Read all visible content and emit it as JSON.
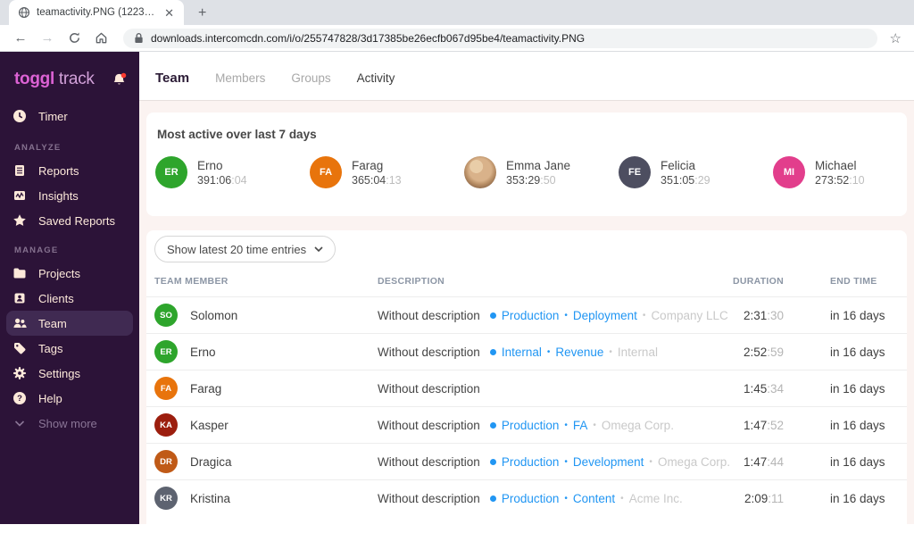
{
  "browser": {
    "tab_title": "teamactivity.PNG (1223×630)",
    "url": "downloads.intercomcdn.com/i/o/255747828/3d17385be26ecfb067d95be4/teamactivity.PNG"
  },
  "sidebar": {
    "logo_bold": "toggl",
    "logo_light": "track",
    "timer_label": "Timer",
    "analyze_label": "ANALYZE",
    "manage_label": "MANAGE",
    "analyze_items": [
      "Reports",
      "Insights",
      "Saved Reports"
    ],
    "manage_items": [
      "Projects",
      "Clients",
      "Team",
      "Tags",
      "Settings",
      "Help"
    ],
    "show_more_label": "Show more"
  },
  "topnav": {
    "title": "Team",
    "tabs": [
      "Members",
      "Groups",
      "Activity"
    ]
  },
  "most_active": {
    "title": "Most active over last 7 days",
    "people": [
      {
        "initials": "ER",
        "name": "Erno",
        "time_main": "391:06",
        "time_sec": ":04",
        "color": "#2EA52C"
      },
      {
        "initials": "FA",
        "name": "Farag",
        "time_main": "365:04",
        "time_sec": ":13",
        "color": "#E8740C"
      },
      {
        "initials": "",
        "name": "Emma Jane",
        "time_main": "353:29",
        "time_sec": ":50",
        "photo": true
      },
      {
        "initials": "FE",
        "name": "Felicia",
        "time_main": "351:05",
        "time_sec": ":29",
        "color": "#4D4E60"
      },
      {
        "initials": "MI",
        "name": "Michael",
        "time_main": "273:52",
        "time_sec": ":10",
        "color": "#E23E8C"
      }
    ]
  },
  "filter": {
    "label": "Show latest 20 time entries"
  },
  "table": {
    "headers": [
      "TEAM MEMBER",
      "DESCRIPTION",
      "DURATION",
      "END TIME"
    ],
    "rows": [
      {
        "initials": "SO",
        "color": "#2EA52C",
        "name": "Solomon",
        "description": "Without description",
        "project": "Production",
        "task": "Deployment",
        "client": "Company LLC",
        "duration_main": "2:31",
        "duration_sec": ":30",
        "end_time": "in 16 days"
      },
      {
        "initials": "ER",
        "color": "#2EA52C",
        "name": "Erno",
        "description": "Without description",
        "project": "Internal",
        "task": "Revenue",
        "client": "Internal",
        "duration_main": "2:52",
        "duration_sec": ":59",
        "end_time": "in 16 days"
      },
      {
        "initials": "FA",
        "color": "#E8740C",
        "name": "Farag",
        "description": "Without description",
        "project": "",
        "task": "",
        "client": "",
        "duration_main": "1:45",
        "duration_sec": ":34",
        "end_time": "in 16 days"
      },
      {
        "initials": "KA",
        "color": "#9C1E0E",
        "name": "Kasper",
        "description": "Without description",
        "project": "Production",
        "task": "FA",
        "client": "Omega Corp.",
        "duration_main": "1:47",
        "duration_sec": ":52",
        "end_time": "in 16 days"
      },
      {
        "initials": "DR",
        "color": "#C05A17",
        "name": "Dragica",
        "description": "Without description",
        "project": "Production",
        "task": "Development",
        "client": "Omega Corp.",
        "duration_main": "1:47",
        "duration_sec": ":44",
        "end_time": "in 16 days"
      },
      {
        "initials": "KR",
        "color": "#5D6370",
        "name": "Kristina",
        "description": "Without description",
        "project": "Production",
        "task": "Content",
        "client": "Acme Inc.",
        "duration_main": "2:09",
        "duration_sec": ":11",
        "end_time": "in 16 days"
      }
    ]
  },
  "colors": {
    "sidebar_bg": "#2C1338",
    "sidebar_active_bg": "#402A52",
    "sidebar_text": "#FDE9DA",
    "logo_pink": "#DC62D4",
    "page_bg": "#FBF3F1",
    "link_blue": "#2196F3",
    "client_gray": "#C9C9C9",
    "notification_red": "#FF3B30"
  }
}
